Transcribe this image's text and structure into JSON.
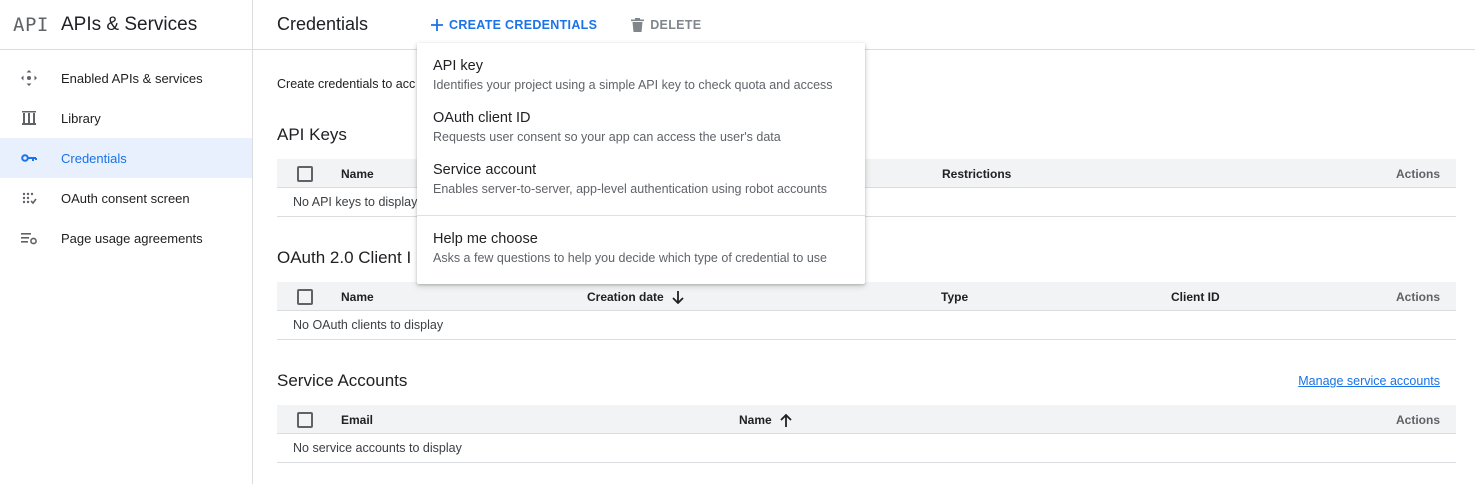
{
  "sidebar": {
    "logo": "API",
    "title": "APIs & Services",
    "items": [
      {
        "label": "Enabled APIs & services",
        "icon": "enabled-apis-icon"
      },
      {
        "label": "Library",
        "icon": "library-icon"
      },
      {
        "label": "Credentials",
        "icon": "key-icon",
        "active": true
      },
      {
        "label": "OAuth consent screen",
        "icon": "oauth-consent-icon"
      },
      {
        "label": "Page usage agreements",
        "icon": "settings-list-icon"
      }
    ]
  },
  "header": {
    "title": "Credentials",
    "create_label": "CREATE CREDENTIALS",
    "delete_label": "DELETE"
  },
  "main": {
    "intro": "Create credentials to acc",
    "api_keys": {
      "title": "API Keys",
      "columns": {
        "name": "Name",
        "restrictions": "Restrictions",
        "actions": "Actions"
      },
      "empty": "No API keys to display"
    },
    "oauth": {
      "title": "OAuth 2.0 Client I",
      "columns": {
        "name": "Name",
        "creation_date": "Creation date",
        "type": "Type",
        "client_id": "Client ID",
        "actions": "Actions"
      },
      "empty": "No OAuth clients to display"
    },
    "service_accounts": {
      "title": "Service Accounts",
      "manage_link": "Manage service accounts",
      "columns": {
        "email": "Email",
        "name": "Name",
        "actions": "Actions"
      },
      "empty": "No service accounts to display"
    }
  },
  "menu": {
    "items": [
      {
        "title": "API key",
        "desc": "Identifies your project using a simple API key to check quota and access"
      },
      {
        "title": "OAuth client ID",
        "desc": "Requests user consent so your app can access the user's data"
      },
      {
        "title": "Service account",
        "desc": "Enables server-to-server, app-level authentication using robot accounts"
      }
    ],
    "help": {
      "title": "Help me choose",
      "desc": "Asks a few questions to help you decide which type of credential to use"
    }
  },
  "colors": {
    "accent": "#1a73e8",
    "active_bg": "#e8f0fe",
    "header_bg": "#f1f3f4"
  }
}
